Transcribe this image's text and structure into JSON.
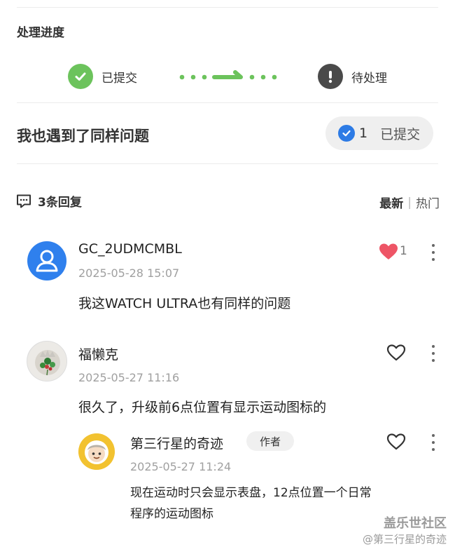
{
  "progress": {
    "title": "处理进度",
    "step_done": {
      "label": "已提交",
      "icon": "check-circle-icon",
      "color": "#6cc35c"
    },
    "step_pending": {
      "label": "待处理",
      "icon": "exclamation-circle-icon",
      "color": "#4a4a4a"
    },
    "arrow_color": "#6cc35c"
  },
  "same_issue": {
    "label": "我也遇到了同样问题",
    "count": "1",
    "button_label": "已提交",
    "icon": "check-circle-icon",
    "accent": "#2d7be5"
  },
  "replies": {
    "count_label": "3条回复",
    "icon": "comment-icon",
    "sort": {
      "active": "最新",
      "separator": "|",
      "other": "热门"
    }
  },
  "comments": [
    {
      "username": "GC_2UDMCMBL",
      "time": "2025-05-28 15:07",
      "text": "我这WATCH ULTRA也有同样的问题",
      "likes": "1",
      "liked": true
    },
    {
      "username": "福懒克",
      "time": "2025-05-27 11:16",
      "text": "很久了，升级前6点位置有显示运动图标的",
      "liked": false
    }
  ],
  "reply": {
    "username": "第三行星的奇迹",
    "tag": "作者",
    "time": "2025-05-27 11:24",
    "text_line1": "现在运动时只会显示表盘，12点位置一个日常",
    "text_line2": "程序的运动图标",
    "liked": false
  },
  "watermark": {
    "line1": "盖乐世社区",
    "line2": "@第三行星的奇迹"
  },
  "colors": {
    "like_red": "#ee5566",
    "avatar_blue": "#2f80ed"
  }
}
